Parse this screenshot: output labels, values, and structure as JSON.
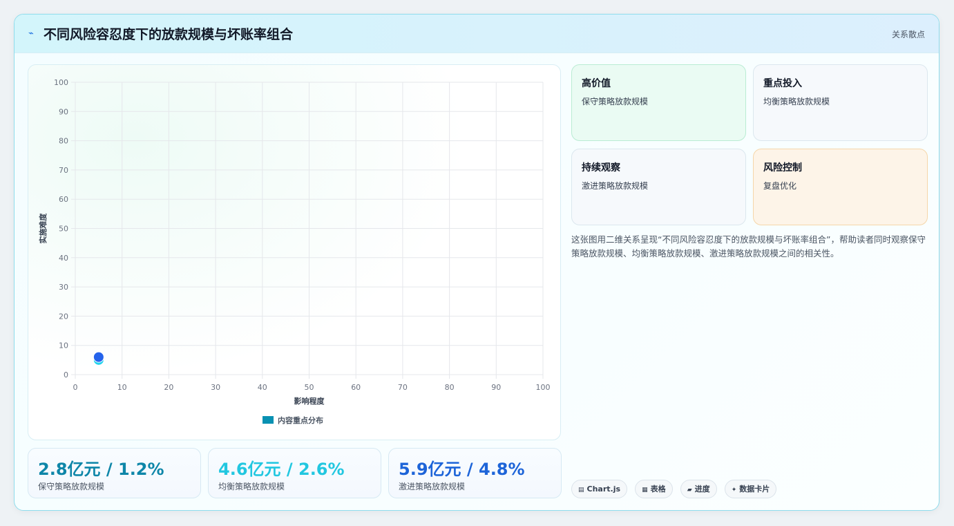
{
  "header": {
    "title": "不同风险容忍度下的放款规模与坏账率组合",
    "tag": "关系散点",
    "icon": "lightning-icon"
  },
  "chart_data": {
    "type": "scatter",
    "xlabel": "影响程度",
    "ylabel": "实施难度",
    "xlim": [
      0,
      100
    ],
    "ylim": [
      0,
      100
    ],
    "x_ticks": [
      "0",
      "10",
      "20",
      "30",
      "40",
      "50",
      "60",
      "70",
      "80",
      "90",
      "100"
    ],
    "y_ticks": [
      "0",
      "10",
      "20",
      "30",
      "40",
      "50",
      "60",
      "70",
      "80",
      "90",
      "100"
    ],
    "grid": true,
    "legend_position": "bottom",
    "series": [
      {
        "name": "内容重点分布",
        "color": "#0891b2",
        "points": [
          {
            "x": 5,
            "y": 5,
            "color": "#22d3ee"
          },
          {
            "x": 5,
            "y": 6,
            "color": "#2563eb"
          }
        ]
      }
    ]
  },
  "stats": [
    {
      "value": "2.8亿元 / 1.2%",
      "label": "保守策略放款规模",
      "color": "#0e86a8"
    },
    {
      "value": "4.6亿元 / 2.6%",
      "label": "均衡策略放款规模",
      "color": "#22c7e0"
    },
    {
      "value": "5.9亿元 / 4.8%",
      "label": "激进策略放款规模",
      "color": "#1d64d8"
    }
  ],
  "quadrants": [
    {
      "title": "高价值",
      "subtitle": "保守策略放款规模",
      "bg": "#eafbf3",
      "border": "#b9ecd3"
    },
    {
      "title": "重点投入",
      "subtitle": "均衡策略放款规模",
      "bg": "#f6f9fc",
      "border": "#dbe7ee"
    },
    {
      "title": "持续观察",
      "subtitle": "激进策略放款规模",
      "bg": "#f6f9fc",
      "border": "#dbe7ee"
    },
    {
      "title": "风险控制",
      "subtitle": "复盘优化",
      "bg": "#fdf4e8",
      "border": "#f5d6a9"
    }
  ],
  "description": "这张图用二维关系呈现“不同风险容忍度下的放款规模与坏账率组合”，帮助读者同时观察保守策略放款规模、均衡策略放款规模、激进策略放款规模之间的相关性。",
  "pills": [
    {
      "icon": "▤",
      "label": "Chart.js"
    },
    {
      "icon": "▦",
      "label": "表格"
    },
    {
      "icon": "▰",
      "label": "进度"
    },
    {
      "icon": "✦",
      "label": "数据卡片"
    }
  ]
}
